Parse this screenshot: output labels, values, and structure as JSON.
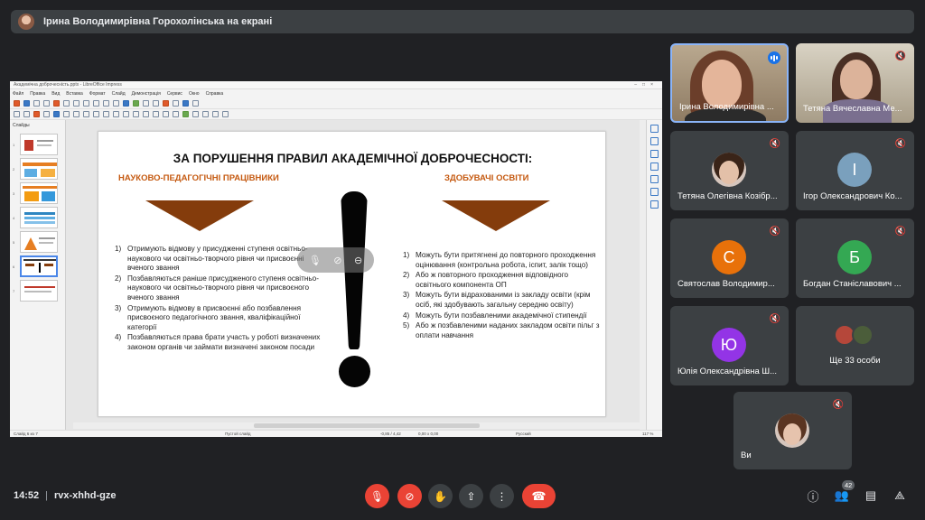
{
  "banner": {
    "presenter_text": "Ірина Володимирівна Горохолінська на екрані"
  },
  "shared_screen": {
    "window_title": "Академічна доброчесність.pptx - LibreOffice Impress",
    "menu": [
      "Файл",
      "Правка",
      "Вид",
      "Вставка",
      "Формат",
      "Слайд",
      "Демонстрація",
      "Сервис",
      "Окно",
      "Справка"
    ],
    "slides_panel_title": "Слайды",
    "slide_numbers": [
      "1",
      "2",
      "3",
      "4",
      "5",
      "6",
      "7"
    ],
    "active_slide_index": 6,
    "status": {
      "slide": "Слайд 6 из 7",
      "layout": "Пустой слайд",
      "coords": "-0,85 / 4,42",
      "size": "0,00 x 0,00",
      "lang": "Русский",
      "zoom": "117 %"
    },
    "slide": {
      "title": "ЗА ПОРУШЕННЯ ПРАВИЛ АКАДЕМІЧНОЇ ДОБРОЧЕСНОСТІ:",
      "left_heading": "НАУКОВО-ПЕДАГОГІЧНІ ПРАЦІВНИКИ",
      "right_heading": "ЗДОБУВАЧІ ОСВІТИ",
      "left_items": [
        {
          "n": "1)",
          "text": "Отримують відмову у присудженні ступеня освітньо-наукового чи освітньо-творчого рівня чи присвоєнні вченого звання"
        },
        {
          "n": "2)",
          "text": "Позбавляються раніше присудженого ступеня освітньо-наукового чи освітньо-творчого рівня чи присвоєного вченого звання"
        },
        {
          "n": "3)",
          "text": "Отримують відмову в присвоєнні або позбавлення присвоєного педагогічного звання, кваліфікаційної категорії"
        },
        {
          "n": "4)",
          "text": "Позбавляються права брати участь у роботі визначених законом органів чи займати визначені законом посади"
        }
      ],
      "right_items": [
        {
          "n": "1)",
          "text": "Можуть бути притягнені до повторного проходження оцінювання (контрольна робота, іспит, залік тощо)"
        },
        {
          "n": "2)",
          "text": "Або ж повторного проходження відповідного освітнього компонента ОП"
        },
        {
          "n": "3)",
          "text": "Можуть бути відрахованими із закладу освіти (крім осіб, які здобувають загальну середню освіту)"
        },
        {
          "n": "4)",
          "text": "Можуть бути позбавленими академічної стипендії"
        },
        {
          "n": "5)",
          "text": "Або ж позбавленими наданих закладом освіти пільг з оплати навчання"
        }
      ]
    }
  },
  "participants": [
    {
      "name": "Ірина Володимирівна ...",
      "type": "video",
      "speaking": true
    },
    {
      "name": "Тетяна Вячеславна Ме...",
      "type": "video",
      "muted": true
    },
    {
      "name": "Тетяна Олегівна Козібр...",
      "type": "photo",
      "muted": true
    },
    {
      "name": "Ігор Олександрович Ко...",
      "type": "letter",
      "letter": "І",
      "color": "#7aa0bd",
      "muted": true
    },
    {
      "name": "Святослав Володимир...",
      "type": "letter",
      "letter": "С",
      "color": "#e8710a",
      "muted": true
    },
    {
      "name": "Богдан Станіславович ...",
      "type": "letter",
      "letter": "Б",
      "color": "#34a853",
      "muted": true
    },
    {
      "name": "Юлія Олександрівна Ш...",
      "type": "letter",
      "letter": "Ю",
      "color": "#9334e6",
      "muted": true
    },
    {
      "name": "Ще 33 особи",
      "type": "group"
    },
    {
      "name": "Ви",
      "type": "photo",
      "muted": true
    }
  ],
  "bottom_bar": {
    "time": "14:52",
    "separator": "|",
    "meeting_code": "rvx-xhhd-gze",
    "participants_count": "42",
    "controls": [
      "mic-off",
      "camera-off",
      "raise-hand",
      "present",
      "more",
      "hang-up"
    ],
    "right_icons": [
      "info",
      "people",
      "chat",
      "activities"
    ]
  },
  "icons": {
    "muted": "mic-off-icon",
    "hangup": "call-end-icon"
  },
  "colors": {
    "background": "#202124",
    "tile": "#3c4043",
    "danger": "#ea4335",
    "accent": "#1a73e8",
    "slide_heading": "#c55a11",
    "arrow": "#843c0c"
  }
}
